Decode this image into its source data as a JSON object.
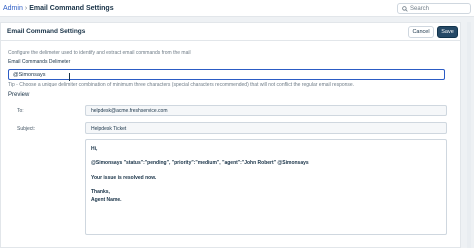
{
  "breadcrumb": {
    "root": "Admin",
    "separator": "›",
    "current": "Email Command Settings"
  },
  "search": {
    "placeholder": "Search"
  },
  "panel": {
    "title": "Email Command Settings",
    "cancel_label": "Cancel",
    "save_label": "Save",
    "description": "Configure the delimeter used to identify and extract email commands from the mail",
    "delimiter_label": "Email Commands Delimeter",
    "delimiter_value": "@Simonsays",
    "tip": "Tip - Choose a unique delimiter combination of minimum three characters (special characters recommended) that will not conflict the regular email response."
  },
  "preview": {
    "title": "Preview",
    "to_label": "To:",
    "to_value": "helpdesk@acme.freshservice.com",
    "subject_label": "Subject:",
    "subject_value": "Helpdesk Ticket",
    "body": {
      "greeting": "Hi,",
      "command": "@Simonsays \"status\":\"pending\", \"priority\":\"medium\", \"agent\":\"John Robert\" @Simonsays",
      "message": "Your issue is resolved now.",
      "closing": "Thanks,",
      "signature": "Agent Name."
    }
  },
  "colors": {
    "accent": "#2c5cc5",
    "primary_button": "#264966",
    "page_background": "#eef1f4"
  }
}
